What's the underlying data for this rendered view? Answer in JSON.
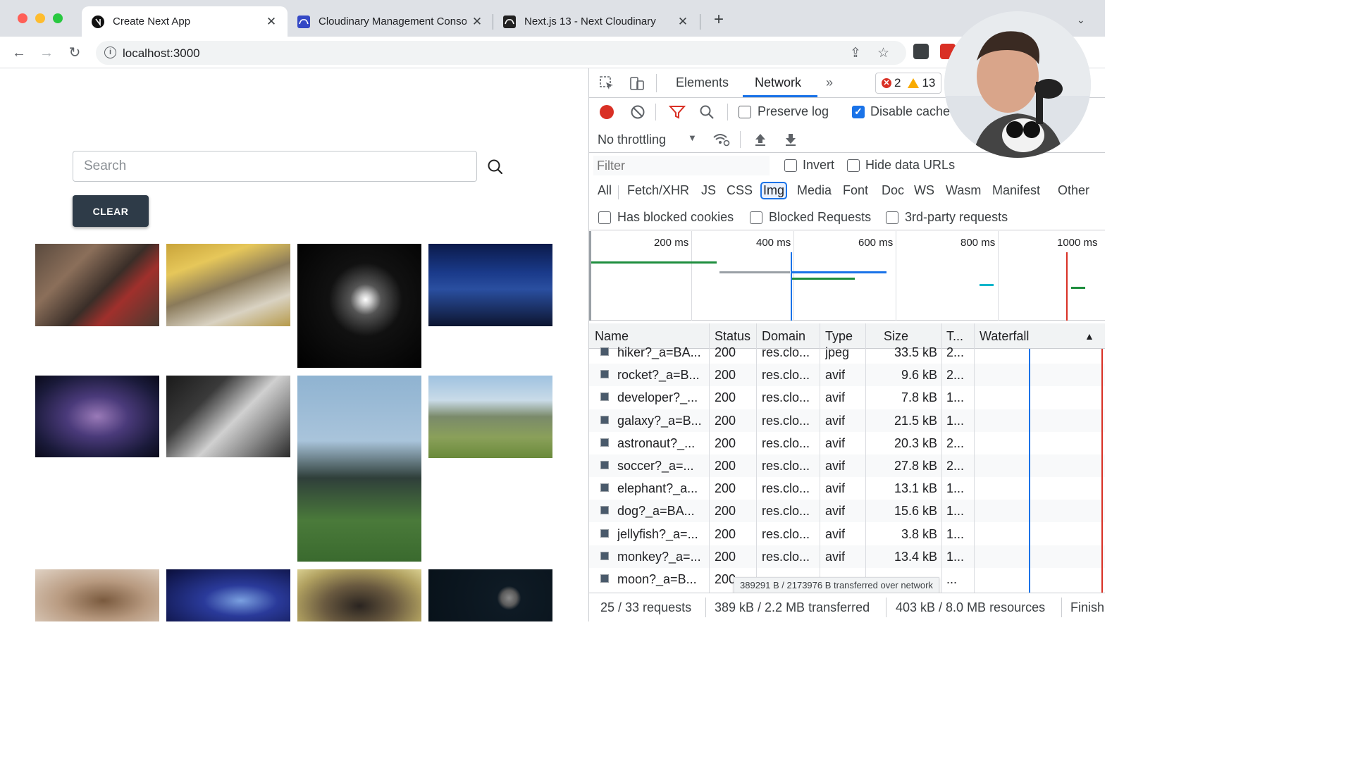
{
  "browser": {
    "tabs": [
      {
        "title": "Create Next App",
        "favicon": "nextjs-icon",
        "active": true
      },
      {
        "title": "Cloudinary Management Console",
        "favicon": "cloudinary-icon",
        "active": false
      },
      {
        "title": "Next.js 13 - Next Cloudinary",
        "favicon": "cloudinary-icon",
        "active": false
      }
    ],
    "url": "localhost:3000"
  },
  "page": {
    "search": {
      "placeholder": "Search",
      "value": ""
    },
    "clear_label": "CLEAR",
    "images": [
      {
        "subject": "guitarist"
      },
      {
        "subject": "hiker"
      },
      {
        "subject": "rocket"
      },
      {
        "subject": "developer"
      },
      {
        "subject": "galaxy"
      },
      {
        "subject": "astronaut"
      },
      {
        "subject": "soccer"
      },
      {
        "subject": "elephant"
      },
      {
        "subject": "dog"
      },
      {
        "subject": "jellyfish"
      },
      {
        "subject": "monkey"
      },
      {
        "subject": "moon"
      }
    ]
  },
  "devtools": {
    "tabs": {
      "elements": "Elements",
      "network": "Network",
      "more": "»"
    },
    "errors": "2",
    "warnings": "13",
    "controls": {
      "preserve_log": "Preserve log",
      "disable_cache": "Disable cache",
      "throttling": "No throttling"
    },
    "filter": {
      "placeholder": "Filter",
      "invert": "Invert",
      "hide_data_urls": "Hide data URLs"
    },
    "types": [
      "All",
      "Fetch/XHR",
      "JS",
      "CSS",
      "Img",
      "Media",
      "Font",
      "Doc",
      "WS",
      "Wasm",
      "Manifest",
      "Other"
    ],
    "active_type": "Img",
    "blocked": {
      "has_blocked_cookies": "Has blocked cookies",
      "blocked_requests": "Blocked Requests",
      "third_party": "3rd-party requests"
    },
    "timeline_ticks": [
      "200 ms",
      "400 ms",
      "600 ms",
      "800 ms",
      "1000 ms"
    ],
    "columns": {
      "name": "Name",
      "status": "Status",
      "domain": "Domain",
      "type": "Type",
      "size": "Size",
      "time": "T...",
      "waterfall": "Waterfall"
    },
    "rows": [
      {
        "name": "hiker?_a=BA...",
        "status": "200",
        "domain": "res.clo...",
        "type": "jpeg",
        "size": "33.5 kB",
        "time": "2..."
      },
      {
        "name": "rocket?_a=B...",
        "status": "200",
        "domain": "res.clo...",
        "type": "avif",
        "size": "9.6 kB",
        "time": "2..."
      },
      {
        "name": "developer?_...",
        "status": "200",
        "domain": "res.clo...",
        "type": "avif",
        "size": "7.8 kB",
        "time": "1..."
      },
      {
        "name": "galaxy?_a=B...",
        "status": "200",
        "domain": "res.clo...",
        "type": "avif",
        "size": "21.5 kB",
        "time": "1..."
      },
      {
        "name": "astronaut?_...",
        "status": "200",
        "domain": "res.clo...",
        "type": "avif",
        "size": "20.3 kB",
        "time": "2..."
      },
      {
        "name": "soccer?_a=...",
        "status": "200",
        "domain": "res.clo...",
        "type": "avif",
        "size": "27.8 kB",
        "time": "2..."
      },
      {
        "name": "elephant?_a...",
        "status": "200",
        "domain": "res.clo...",
        "type": "avif",
        "size": "13.1 kB",
        "time": "1..."
      },
      {
        "name": "dog?_a=BA...",
        "status": "200",
        "domain": "res.clo...",
        "type": "avif",
        "size": "15.6 kB",
        "time": "1..."
      },
      {
        "name": "jellyfish?_a=...",
        "status": "200",
        "domain": "res.clo...",
        "type": "avif",
        "size": "3.8 kB",
        "time": "1..."
      },
      {
        "name": "monkey?_a=...",
        "status": "200",
        "domain": "res.clo...",
        "type": "avif",
        "size": "13.4 kB",
        "time": "1..."
      },
      {
        "name": "moon?_a=B...",
        "status": "200",
        "domain": "",
        "type": "",
        "size": "",
        "time": "..."
      }
    ],
    "tooltip": "389291 B / 2173976 B transferred over network",
    "status_bar": {
      "requests": "25 / 33 requests",
      "transferred": "389 kB / 2.2 MB transferred",
      "resources": "403 kB / 8.0 MB resources",
      "finish": "Finish"
    }
  },
  "colors": {
    "accent": "#1a73e8",
    "record": "#d93025",
    "clear_button": "#2e3b48"
  }
}
